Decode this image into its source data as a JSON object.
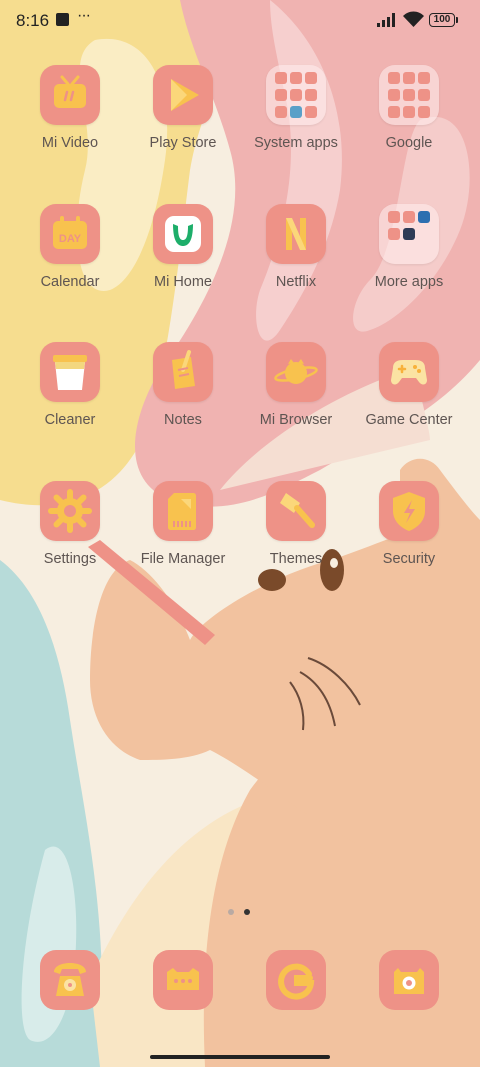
{
  "status_bar": {
    "time": "8:16",
    "battery_level": "100",
    "icons": [
      "notification-square-icon",
      "more-notifications-icon",
      "signal-icon",
      "wifi-icon",
      "battery-icon"
    ]
  },
  "apps": [
    {
      "label": "Mi Video",
      "icon": "tv-icon"
    },
    {
      "label": "Play Store",
      "icon": "play-store-icon"
    },
    {
      "label": "System apps",
      "icon": "folder-icon"
    },
    {
      "label": "Google",
      "icon": "folder-icon"
    },
    {
      "label": "Calendar",
      "icon": "calendar-icon",
      "icon_text": "DAY"
    },
    {
      "label": "Mi Home",
      "icon": "mi-home-icon"
    },
    {
      "label": "Netflix",
      "icon": "netflix-icon"
    },
    {
      "label": "More apps",
      "icon": "folder-icon"
    },
    {
      "label": "Cleaner",
      "icon": "trash-bin-icon"
    },
    {
      "label": "Notes",
      "icon": "notes-icon"
    },
    {
      "label": "Mi Browser",
      "icon": "planet-icon"
    },
    {
      "label": "Game Center",
      "icon": "gamepad-icon"
    },
    {
      "label": "Settings",
      "icon": "gear-icon"
    },
    {
      "label": "File Manager",
      "icon": "sd-card-icon"
    },
    {
      "label": "Themes",
      "icon": "brush-icon"
    },
    {
      "label": "Security",
      "icon": "shield-icon"
    }
  ],
  "dock": [
    {
      "name": "phone",
      "icon": "telephone-icon"
    },
    {
      "name": "messages",
      "icon": "message-icon"
    },
    {
      "name": "google",
      "icon": "google-g-icon"
    },
    {
      "name": "camera",
      "icon": "camera-icon"
    }
  ],
  "page_indicator": {
    "pages": 2,
    "current": 2
  },
  "colors": {
    "icon_tile": "#ee9287",
    "icon_glyph": "#f8c24e",
    "label_text": "#5e5552",
    "wallpaper_yellow": "#f6dd8f",
    "wallpaper_pink": "#f0b3b1",
    "wallpaper_peach": "#f2c29f",
    "wallpaper_teal": "#b7dbd9"
  }
}
